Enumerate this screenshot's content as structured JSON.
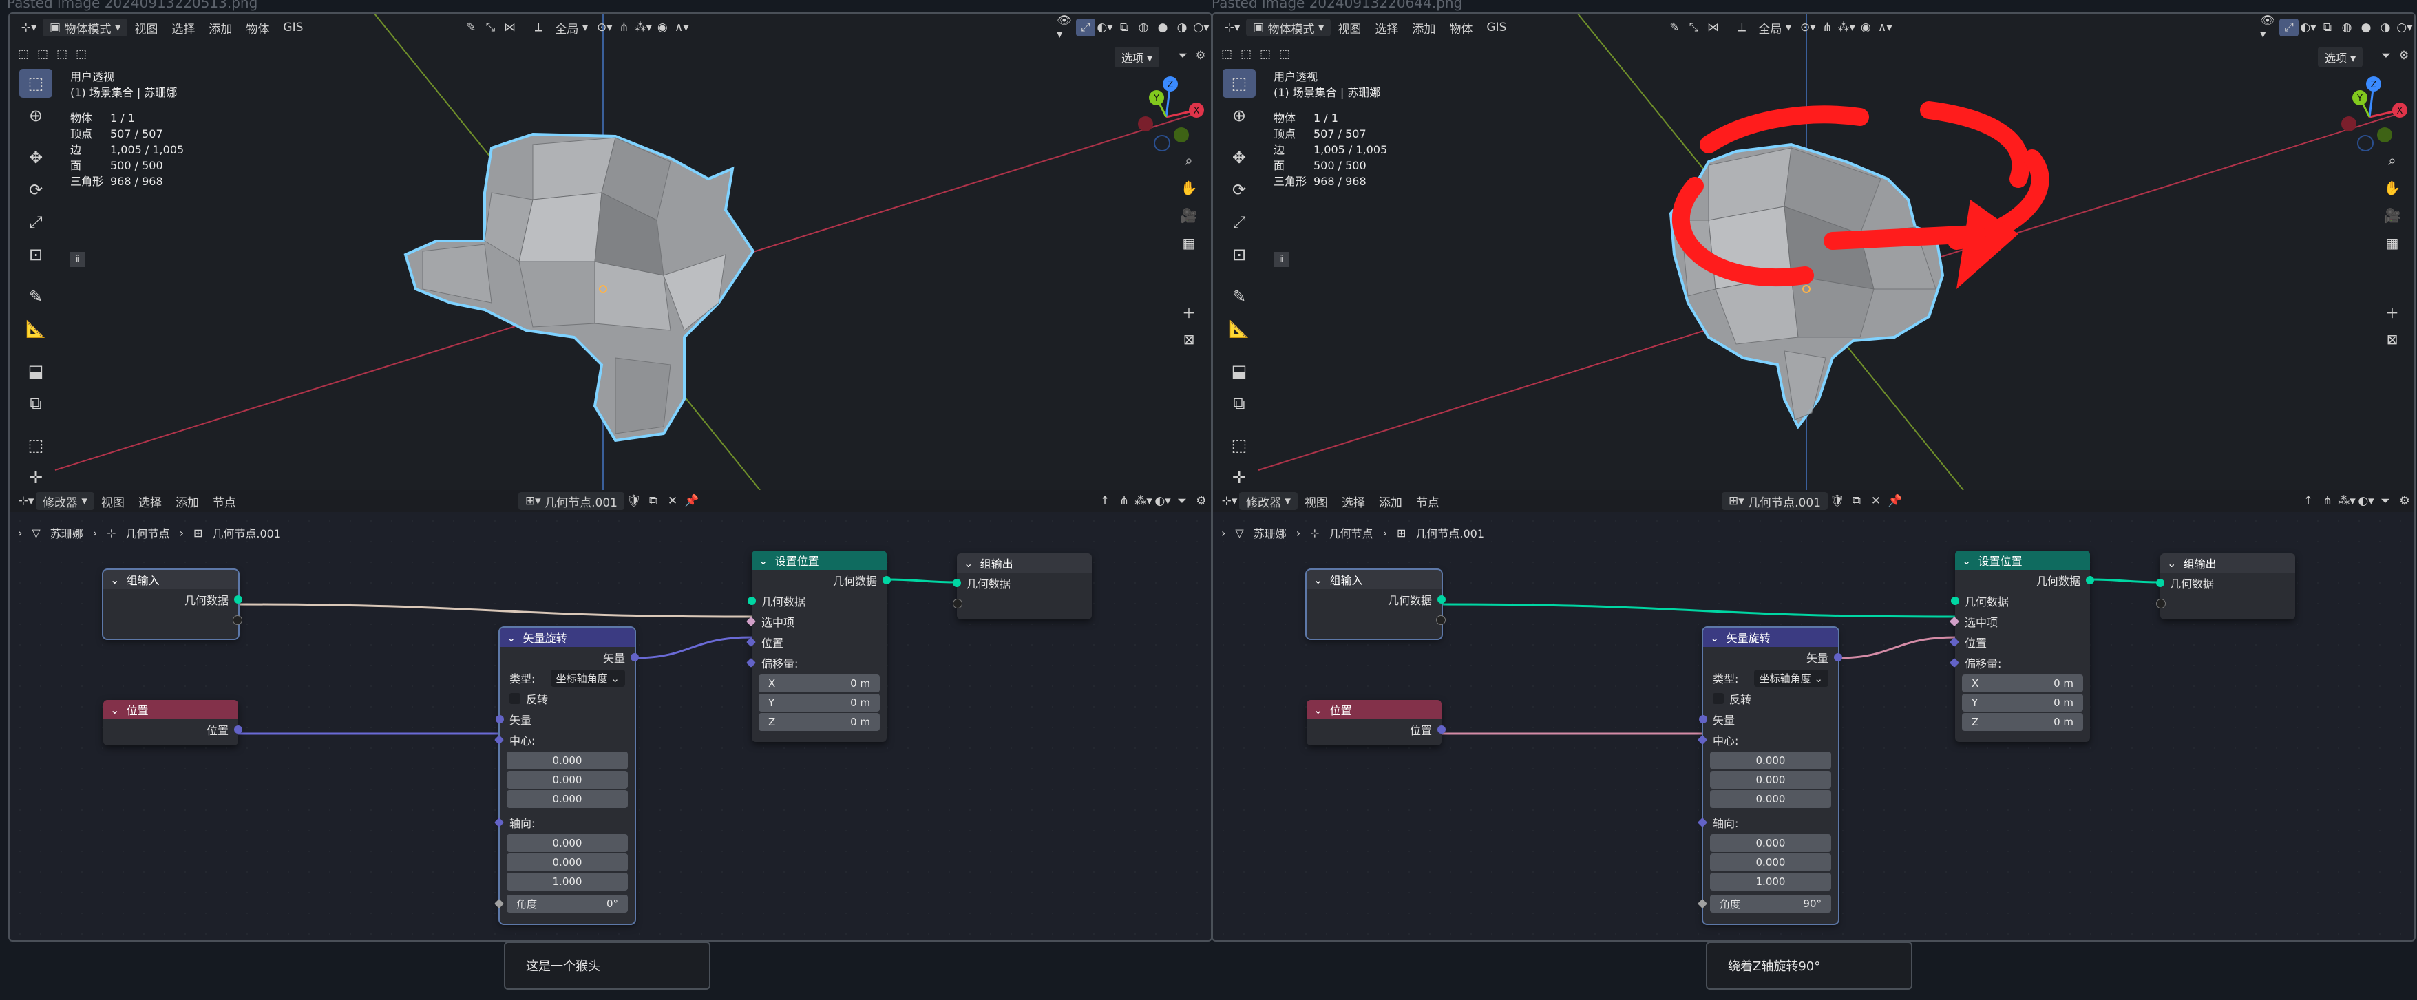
{
  "files": {
    "left_name": "Pasted image 20240913220513.png",
    "right_name": "Pasted image 20240913220644.png"
  },
  "viewport": {
    "mode": "物体模式",
    "menus": [
      "视图",
      "选择",
      "添加",
      "物体",
      "GIS"
    ],
    "transform_orientation": "全局",
    "options": "选项",
    "view_name": "用户透视",
    "collection": "(1) 场景集合 | 苏珊娜",
    "stats": [
      {
        "k": "物体",
        "v": "1 / 1"
      },
      {
        "k": "顶点",
        "v": "507 / 507"
      },
      {
        "k": "边",
        "v": "1,005 / 1,005"
      },
      {
        "k": "面",
        "v": "500 / 500"
      },
      {
        "k": "三角形",
        "v": "968 / 968"
      }
    ],
    "gizmo": {
      "x": "X",
      "y": "Y",
      "z": "Z"
    }
  },
  "node_editor": {
    "type": "修改器",
    "menus": [
      "视图",
      "选择",
      "添加",
      "节点"
    ],
    "tree_name": "几何节点.001",
    "breadcrumb": [
      "苏珊娜",
      "几何节点",
      "几何节点.001"
    ]
  },
  "nodes": {
    "group_input": {
      "title": "组输入",
      "geometry": "几何数据"
    },
    "position": {
      "title": "位置",
      "output": "位置"
    },
    "vector_rotate": {
      "title": "矢量旋转",
      "output": "矢量",
      "type_label": "类型:",
      "type_value": "坐标轴角度",
      "invert": "反转",
      "vector": "矢量",
      "center": "中心:",
      "center_values": [
        "0.000",
        "0.000",
        "0.000"
      ],
      "axis": "轴向:",
      "axis_values": [
        "0.000",
        "0.000",
        "1.000"
      ],
      "angle_label": "角度"
    },
    "set_position": {
      "title": "设置位置",
      "geometry_out": "几何数据",
      "geometry_in": "几何数据",
      "selection": "选中项",
      "position": "位置",
      "offset": "偏移量:",
      "offset_values": [
        {
          "k": "X",
          "v": "0 m"
        },
        {
          "k": "Y",
          "v": "0 m"
        },
        {
          "k": "Z",
          "v": "0 m"
        }
      ]
    },
    "group_output": {
      "title": "组输出",
      "geometry": "几何数据"
    }
  },
  "panels": [
    {
      "angle": "0°",
      "caption": "这是一个猴头"
    },
    {
      "angle": "90°",
      "caption": "绕着Z轴旋转90°"
    }
  ],
  "colors": {
    "geometry_socket": "#00d6a3",
    "vector_socket": "#6363c7",
    "position_header": "#83314a",
    "rotate_header": "#3b3b82",
    "setpos_header": "#0f6b5f",
    "annotation": "#ff1c1c"
  }
}
